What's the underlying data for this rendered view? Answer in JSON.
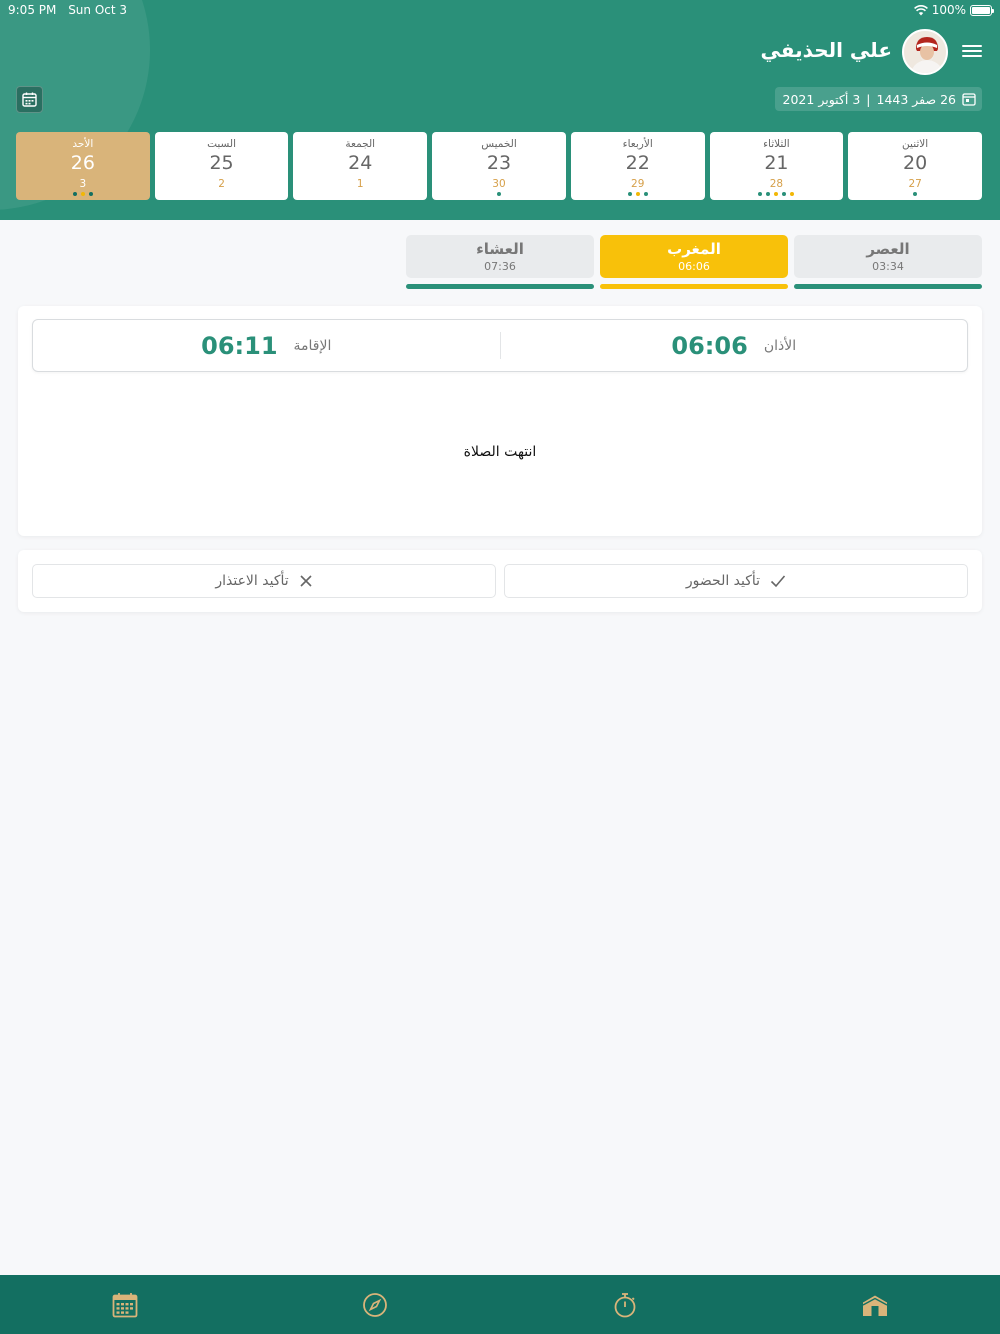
{
  "status": {
    "time": "9:05 PM",
    "date": "Sun Oct 3",
    "battery": "100%"
  },
  "user": {
    "name": "علي الحذيفي"
  },
  "date_pill": {
    "hijri": "26 صفر 1443",
    "separator": "|",
    "gregorian": "3 أكتوبر 2021"
  },
  "days": [
    {
      "name": "الاثنين",
      "num": "20",
      "hijri": "27",
      "dots": [
        "#2a9079"
      ]
    },
    {
      "name": "الثلاثاء",
      "num": "21",
      "hijri": "28",
      "dots": [
        "#2a9079",
        "#2a9079",
        "#f2b705",
        "#2a9079",
        "#f2b705"
      ]
    },
    {
      "name": "الأربعاء",
      "num": "22",
      "hijri": "29",
      "dots": [
        "#2a9079",
        "#f2b705",
        "#2a9079"
      ]
    },
    {
      "name": "الخميس",
      "num": "23",
      "hijri": "30",
      "dots": [
        "#2a9079"
      ]
    },
    {
      "name": "الجمعة",
      "num": "24",
      "hijri": "1",
      "dots": []
    },
    {
      "name": "السبت",
      "num": "25",
      "hijri": "2",
      "dots": []
    },
    {
      "name": "الأحد",
      "num": "26",
      "hijri": "3",
      "dots": [
        "#136f61",
        "#f2b705",
        "#136f61"
      ],
      "active": true
    }
  ],
  "prayers": [
    {
      "name": "العصر",
      "time": "03:34"
    },
    {
      "name": "المغرب",
      "time": "06:06",
      "active": true
    },
    {
      "name": "العشاء",
      "time": "07:36"
    }
  ],
  "detail": {
    "adhan_label": "الأذان",
    "adhan_time": "06:06",
    "iqama_label": "الإقامة",
    "iqama_time": "06:11",
    "status_text": "انتهت الصلاة"
  },
  "actions": {
    "confirm_label": "تأكيد الحضور",
    "excuse_label": "تأكيد الاعتذار"
  },
  "colors": {
    "primary": "#2a9079",
    "accent": "#f8c10a",
    "gold": "#d9b47a",
    "nav": "#136f61"
  }
}
